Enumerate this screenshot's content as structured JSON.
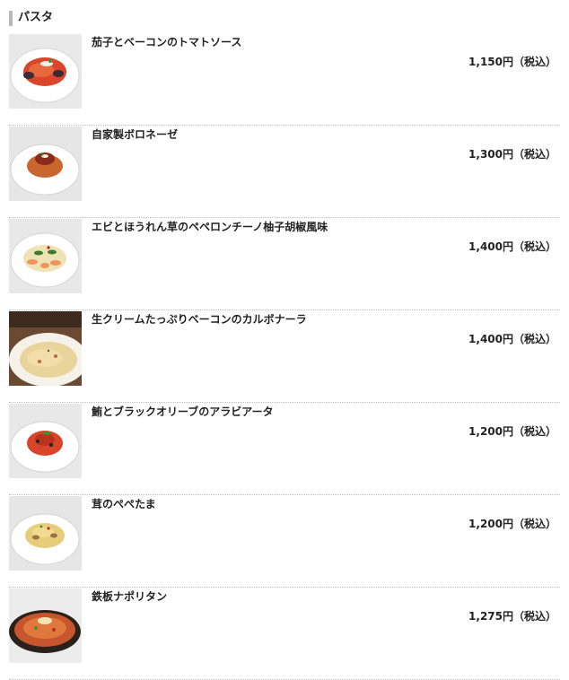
{
  "section": {
    "title": "パスタ"
  },
  "items": [
    {
      "name": "茄子とベーコンのトマトソース",
      "price": "1,150円（税込）",
      "image": "pasta-tomato-eggplant"
    },
    {
      "name": "自家製ボロネーゼ",
      "price": "1,300円（税込）",
      "image": "pasta-bolognese"
    },
    {
      "name": "エビとほうれん草のペペロンチーノ柚子胡椒風味",
      "price": "1,400円（税込）",
      "image": "pasta-shrimp-spinach"
    },
    {
      "name": "生クリームたっぷりベーコンのカルボナーラ",
      "price": "1,400円（税込）",
      "image": "pasta-carbonara"
    },
    {
      "name": "鮪とブラックオリーブのアラビアータ",
      "price": "1,200円（税込）",
      "image": "pasta-arrabbiata"
    },
    {
      "name": "茸のぺぺたま",
      "price": "1,200円（税込）",
      "image": "pasta-mushroom"
    },
    {
      "name": "鉄板ナポリタン",
      "price": "1,275円（税込）",
      "image": "pasta-napolitan"
    }
  ]
}
